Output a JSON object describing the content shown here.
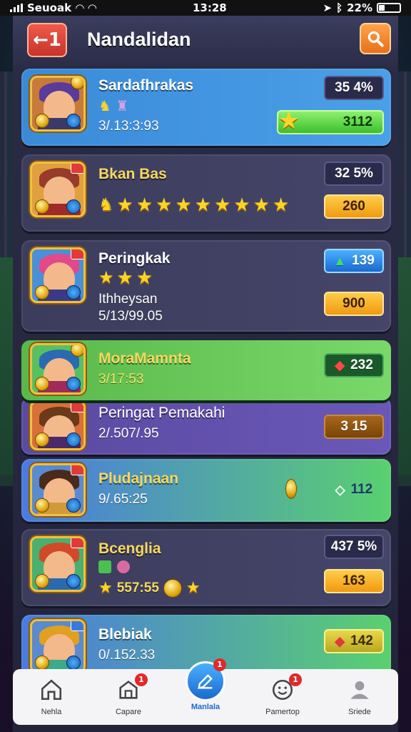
{
  "status_bar": {
    "carrier": "Seuoak",
    "time": "13:28",
    "battery": "22%"
  },
  "header": {
    "title": "Nandalidan",
    "back_label": "←1"
  },
  "cards": [
    {
      "name": "Sardafhrakas",
      "sub": "3/.13:3:93",
      "pill_top": "35 4%",
      "pill_bottom": "3112"
    },
    {
      "name": "Bkan Bas",
      "pill_top": "32 5%",
      "pill_bottom": "260"
    },
    {
      "name": "Peringkak",
      "sub1": "Ithheysan",
      "sub2": "5/13/99.05",
      "pill_top": "139",
      "pill_bottom": "900"
    },
    {
      "name": "MoraMamnta",
      "sub": "3/17:53",
      "pill": "232"
    },
    {
      "name": "Peringat Pemakahi",
      "sub": "2/.507/.95",
      "pill": "3 15"
    },
    {
      "name": "Pludajnaan",
      "sub": "9/.65:25",
      "pill": "112"
    },
    {
      "name": "Bcenglia",
      "sub": "557:55",
      "pill_top": "437 5%",
      "pill_bottom": "163"
    },
    {
      "name": "Blebiak",
      "sub": "0/.152.33",
      "pill": "142"
    }
  ],
  "nav": [
    {
      "label": "Nehla",
      "icon": "home-icon"
    },
    {
      "label": "Capare",
      "icon": "house-icon",
      "badge": "1"
    },
    {
      "label": "Manlala",
      "icon": "edit-icon",
      "badge": "1",
      "active": true
    },
    {
      "label": "Pamertop",
      "icon": "smile-icon",
      "badge": "1"
    },
    {
      "label": "Sriede",
      "icon": "user-icon"
    }
  ],
  "colors": {
    "accent": "#1a6ad0",
    "gold": "#f6d860",
    "green": "#3cbf2c",
    "orange": "#f09a10"
  }
}
